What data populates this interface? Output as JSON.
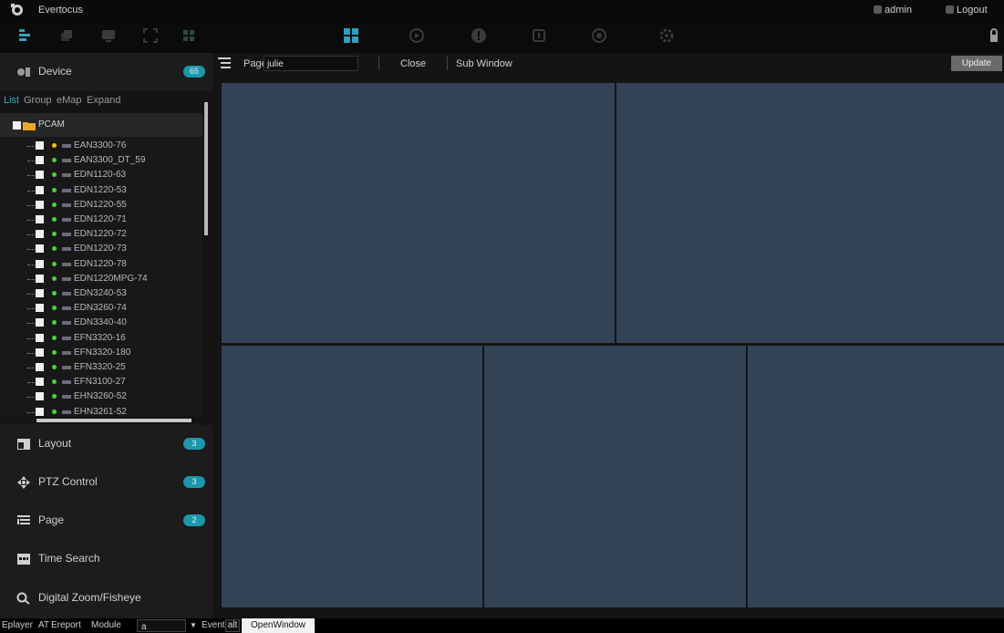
{
  "titlebar": {
    "app_title": "Evertocus",
    "user": "admin",
    "logout": "Logout"
  },
  "toolbar": {
    "left_icons": [
      "tree-icon",
      "window-icon",
      "monitor-icon",
      "fullscreen-icon",
      "tiles-icon"
    ],
    "center_icons": [
      "layout-icon",
      "playback-icon",
      "alert-icon",
      "page-icon",
      "target-icon",
      "gear-icon"
    ],
    "active_color": "#2fa2bf"
  },
  "device_panel": {
    "label": "Device",
    "badge": "65",
    "tabs": [
      "List",
      "Group",
      "eMap",
      "Expand"
    ],
    "root": "PCAM",
    "devices": [
      "EAN3300-76",
      "EAN3300_DT_59",
      "EDN1120-63",
      "EDN1220-53",
      "EDN1220-55",
      "EDN1220-71",
      "EDN1220-72",
      "EDN1220-73",
      "EDN1220-78",
      "EDN1220MPG-74",
      "EDN3240-53",
      "EDN3260-74",
      "EDN3340-40",
      "EFN3320-16",
      "EFN3320-180",
      "EFN3320-25",
      "EFN3100-27",
      "EHN3260-52",
      "EHN3261-52"
    ]
  },
  "sections": [
    {
      "label": "Layout",
      "badge": "3",
      "icon": "layout-icon"
    },
    {
      "label": "PTZ Control",
      "badge": "3",
      "icon": "ptz-icon"
    },
    {
      "label": "Page",
      "badge": "2",
      "icon": "page-icon"
    },
    {
      "label": "Time Search",
      "badge": "",
      "icon": "calendar-icon"
    },
    {
      "label": "Digital Zoom/Fisheye",
      "badge": "",
      "icon": "zoom-icon"
    }
  ],
  "pagebar": {
    "page_label": "Page",
    "page_value": "julie",
    "close": "Close",
    "sub_window": "Sub Window",
    "update": "Update"
  },
  "bottombar": {
    "player": "Eplayer",
    "at_label": "AT",
    "report": "Ereport",
    "module_label": "Module",
    "module_value": "a",
    "event_label": "Event",
    "event_value": "alt",
    "open_window": "OpenWindow"
  }
}
